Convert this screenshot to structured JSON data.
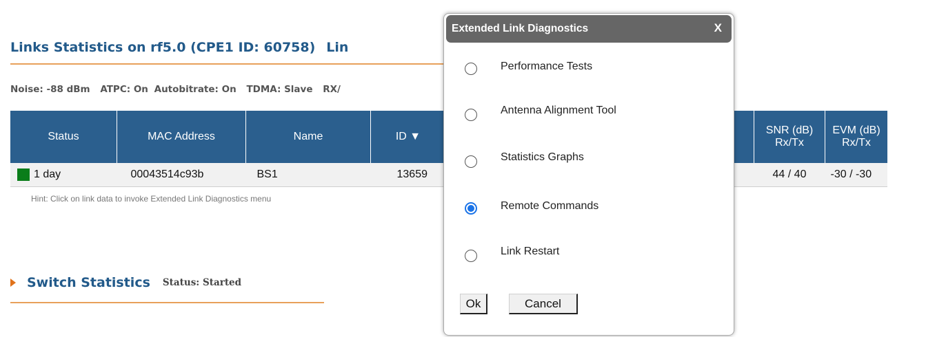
{
  "links": {
    "title": "Links Statistics on rf5.0 (CPE1 ID: 60758)",
    "title_partial": "Lin",
    "status": {
      "noise": "Noise:   -88 dBm",
      "atpc": "ATPC: On",
      "autobitrate": "Autobitrate: On",
      "tdma": "TDMA: Slave",
      "rx": "RX/"
    },
    "table": {
      "headers": {
        "status": "Status",
        "mac": "MAC Address",
        "name": "Name",
        "id": "ID ▼",
        "snr": "SNR (dB)",
        "snr_sub": "Rx/Tx",
        "evm": "EVM (dB)",
        "evm_sub": "Rx/Tx"
      },
      "row": {
        "status": "1 day",
        "mac": "00043514c93b",
        "name": "BS1",
        "id": "13659",
        "snr": "44 / 40",
        "evm": "-30 / -30"
      }
    },
    "hint": "Hint: Click on link data to invoke Extended Link Diagnostics menu"
  },
  "switch": {
    "title": "Switch Statistics",
    "status": "Status: Started"
  },
  "dialog": {
    "title": "Extended Link Diagnostics",
    "close": "X",
    "options": [
      {
        "label": "Performance Tests",
        "checked": false
      },
      {
        "label": "Antenna Alignment Tool",
        "checked": false
      },
      {
        "label": "Statistics Graphs",
        "checked": false
      },
      {
        "label": "Remote Commands",
        "checked": true
      },
      {
        "label": "Link Restart",
        "checked": false
      }
    ],
    "ok": "Ok",
    "cancel": "Cancel"
  },
  "colors": {
    "header_blue": "#2b5f8e",
    "title_blue": "#225a8a",
    "accent_orange": "#e8a05a",
    "status_green": "#0a7d1a",
    "radio_blue": "#1a73e8"
  }
}
